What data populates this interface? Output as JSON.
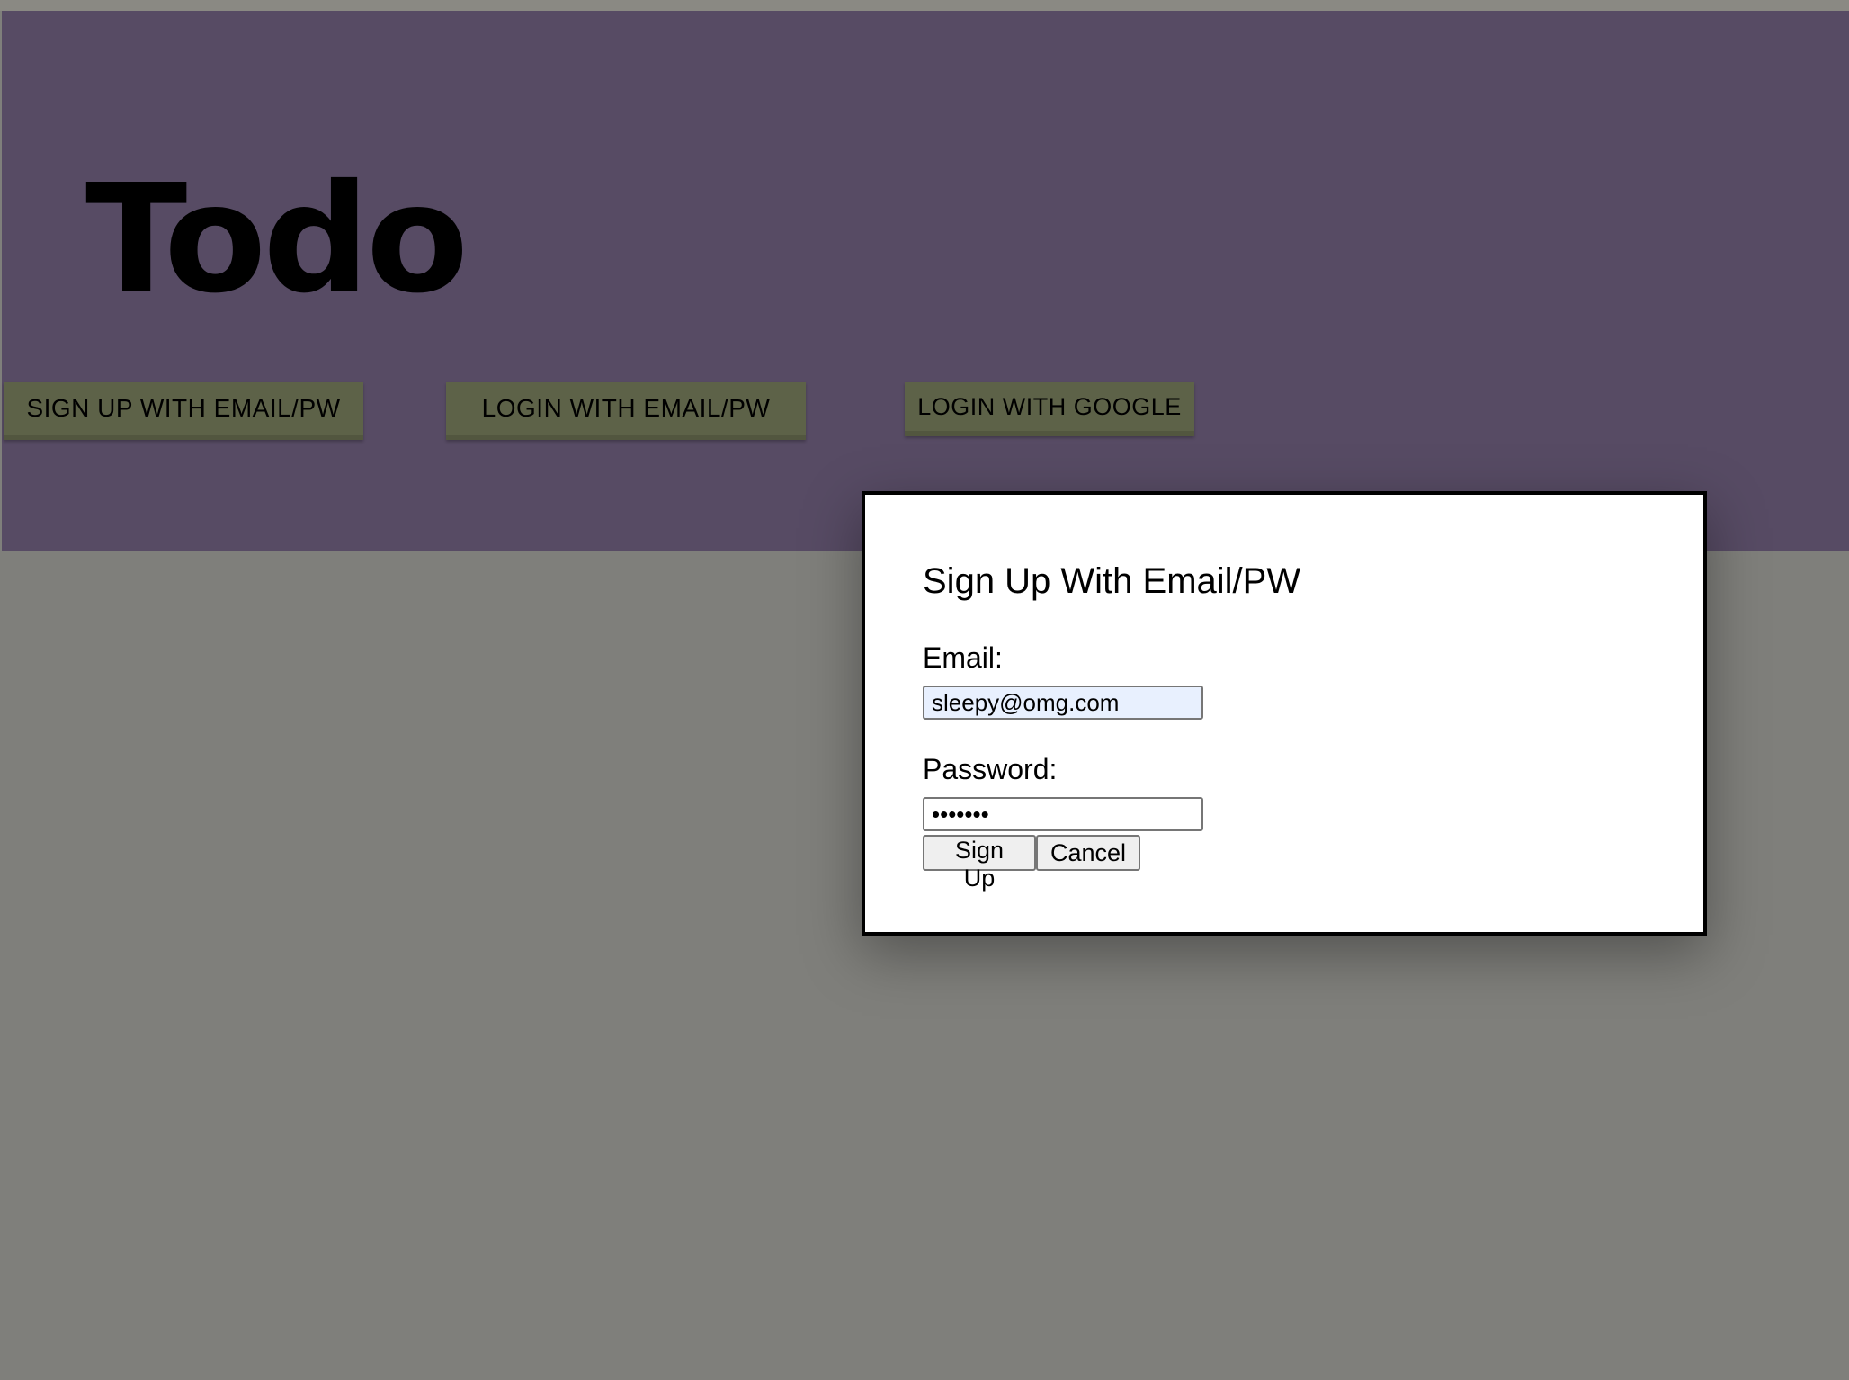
{
  "header": {
    "title": "Todo",
    "buttons": {
      "signup_email": "SIGN UP WITH EMAIL/PW",
      "login_email": "LOGIN WITH EMAIL/PW",
      "login_google": "LOGIN WITH GOOGLE"
    }
  },
  "modal": {
    "title": "Sign Up With Email/PW",
    "email": {
      "label": "Email:",
      "value": "sleepy@omg.com"
    },
    "password": {
      "label": "Password:",
      "value": "•••••••"
    },
    "submit_label": "Sign Up",
    "cancel_label": "Cancel"
  },
  "colors": {
    "background": "#7f7f7b",
    "header": "#574b64",
    "auth_button": "#5d6248",
    "modal": "#ffffff",
    "autofill_input": "#e8f0fe"
  }
}
